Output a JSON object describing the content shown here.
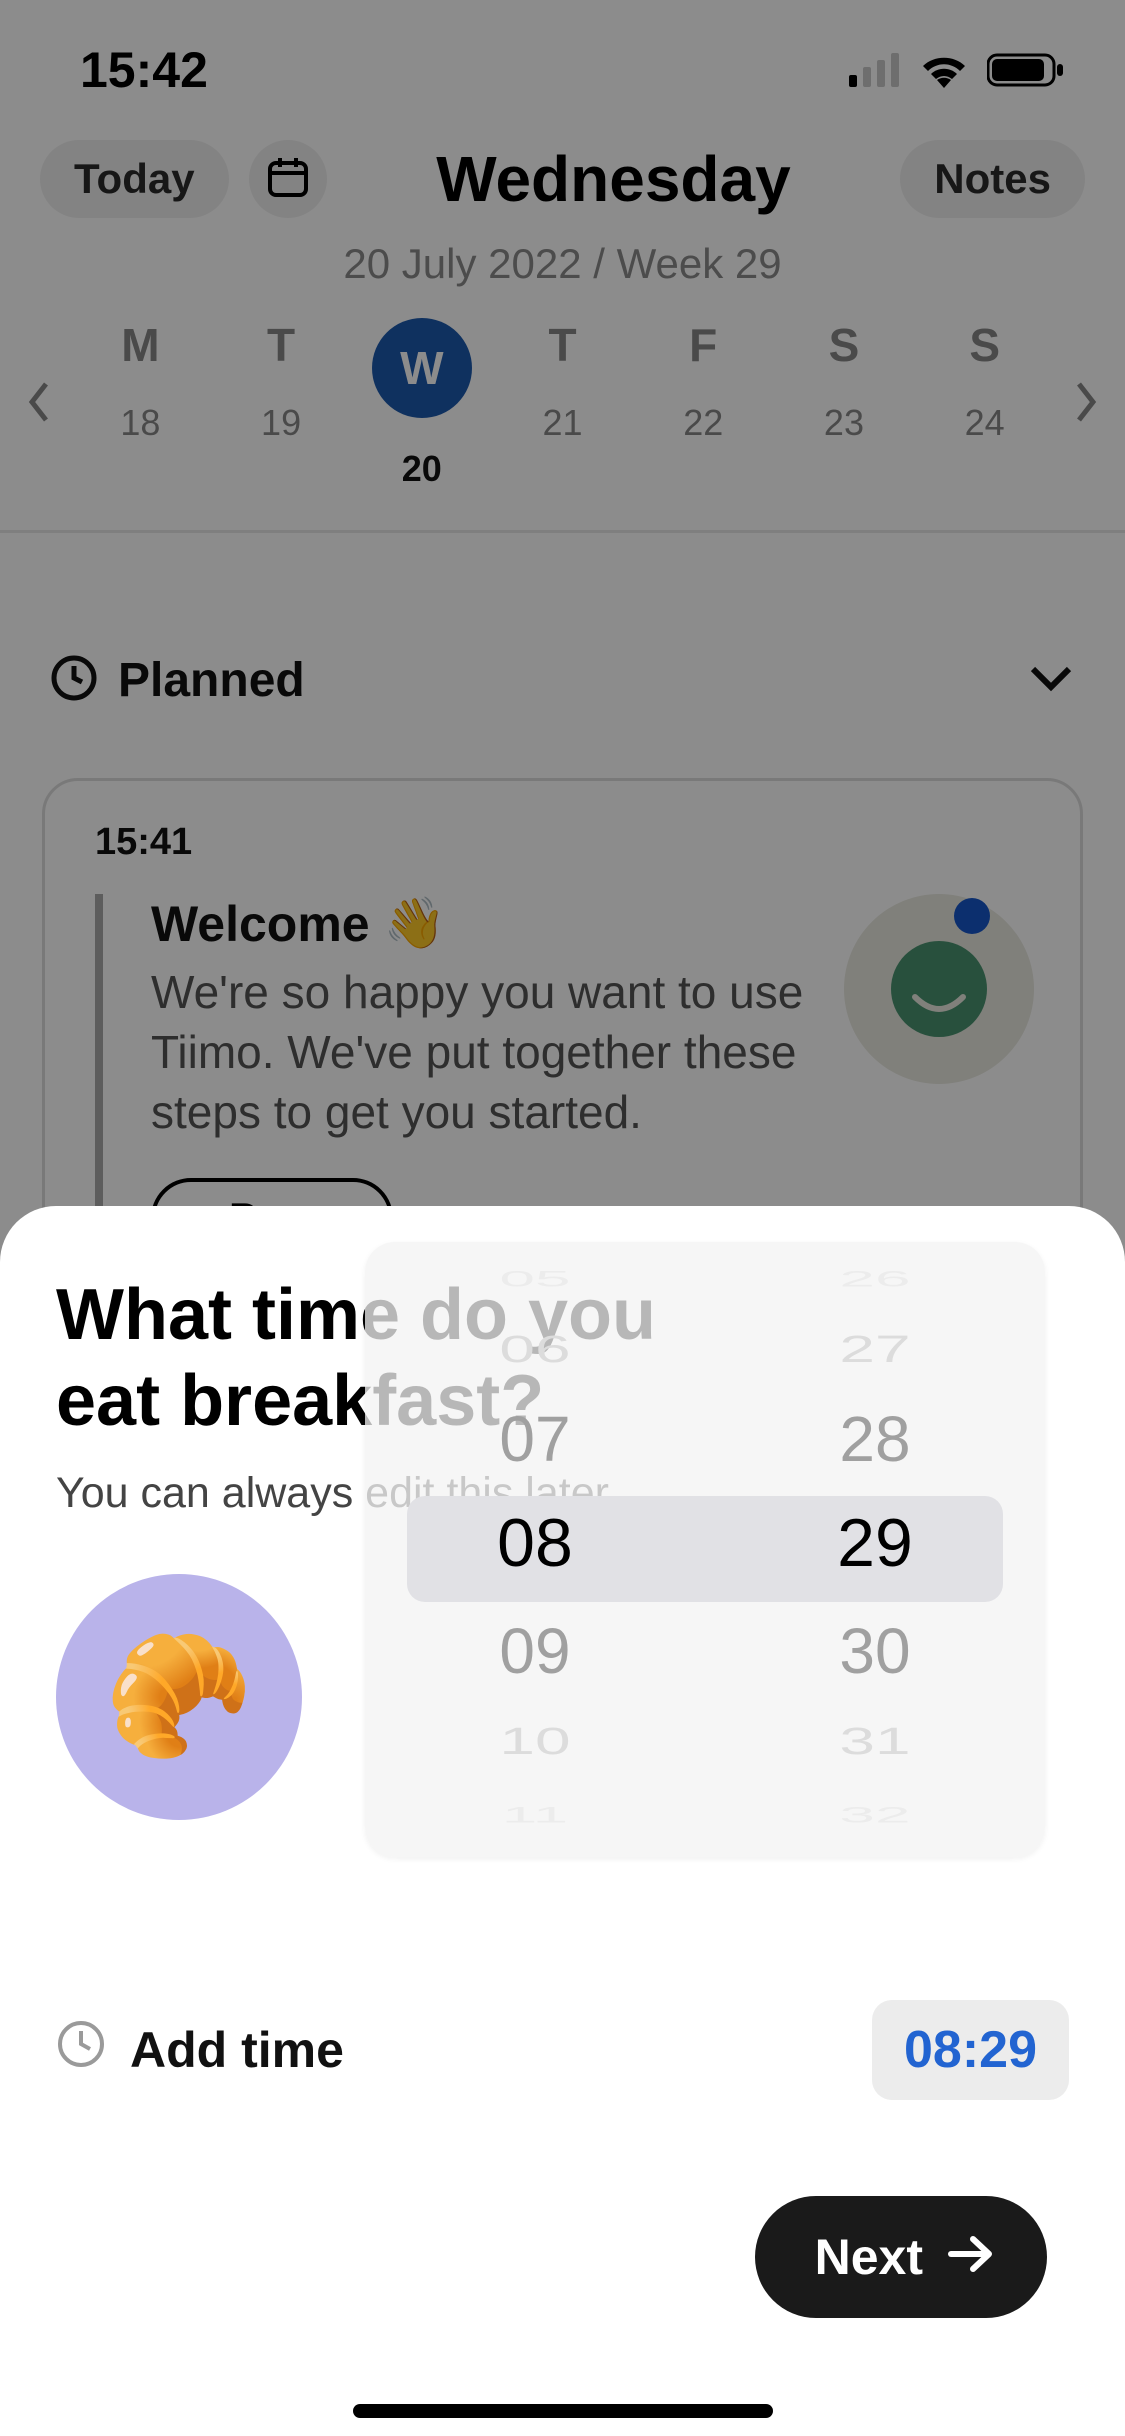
{
  "status": {
    "time": "15:42"
  },
  "header": {
    "today_label": "Today",
    "title": "Wednesday",
    "notes_label": "Notes",
    "subtitle": "20 July 2022 / Week 29"
  },
  "week": {
    "days": [
      {
        "letter": "M",
        "num": "18",
        "selected": false
      },
      {
        "letter": "T",
        "num": "19",
        "selected": false
      },
      {
        "letter": "W",
        "num": "20",
        "selected": true
      },
      {
        "letter": "T",
        "num": "21",
        "selected": false
      },
      {
        "letter": "F",
        "num": "22",
        "selected": false
      },
      {
        "letter": "S",
        "num": "23",
        "selected": false
      },
      {
        "letter": "S",
        "num": "24",
        "selected": false
      }
    ]
  },
  "section": {
    "planned_label": "Planned"
  },
  "card": {
    "time": "15:41",
    "title": "Welcome",
    "emoji": "👋",
    "body": "We're so happy you want to use Tiimo. We've put together these steps to get you started.",
    "pause_label": "Pause"
  },
  "sheet": {
    "title_line1": "What time do you",
    "title_line2": "eat breakfast?",
    "sub": "You can always edit this later.",
    "croissant_emoji": "🥐",
    "add_time_label": "Add time",
    "time_value": "08:29",
    "next_label": "Next"
  },
  "picker": {
    "hours": [
      "05",
      "06",
      "07",
      "08",
      "09",
      "10",
      "11"
    ],
    "minutes": [
      "26",
      "27",
      "28",
      "29",
      "30",
      "31",
      "32"
    ],
    "selected_index": 3
  }
}
